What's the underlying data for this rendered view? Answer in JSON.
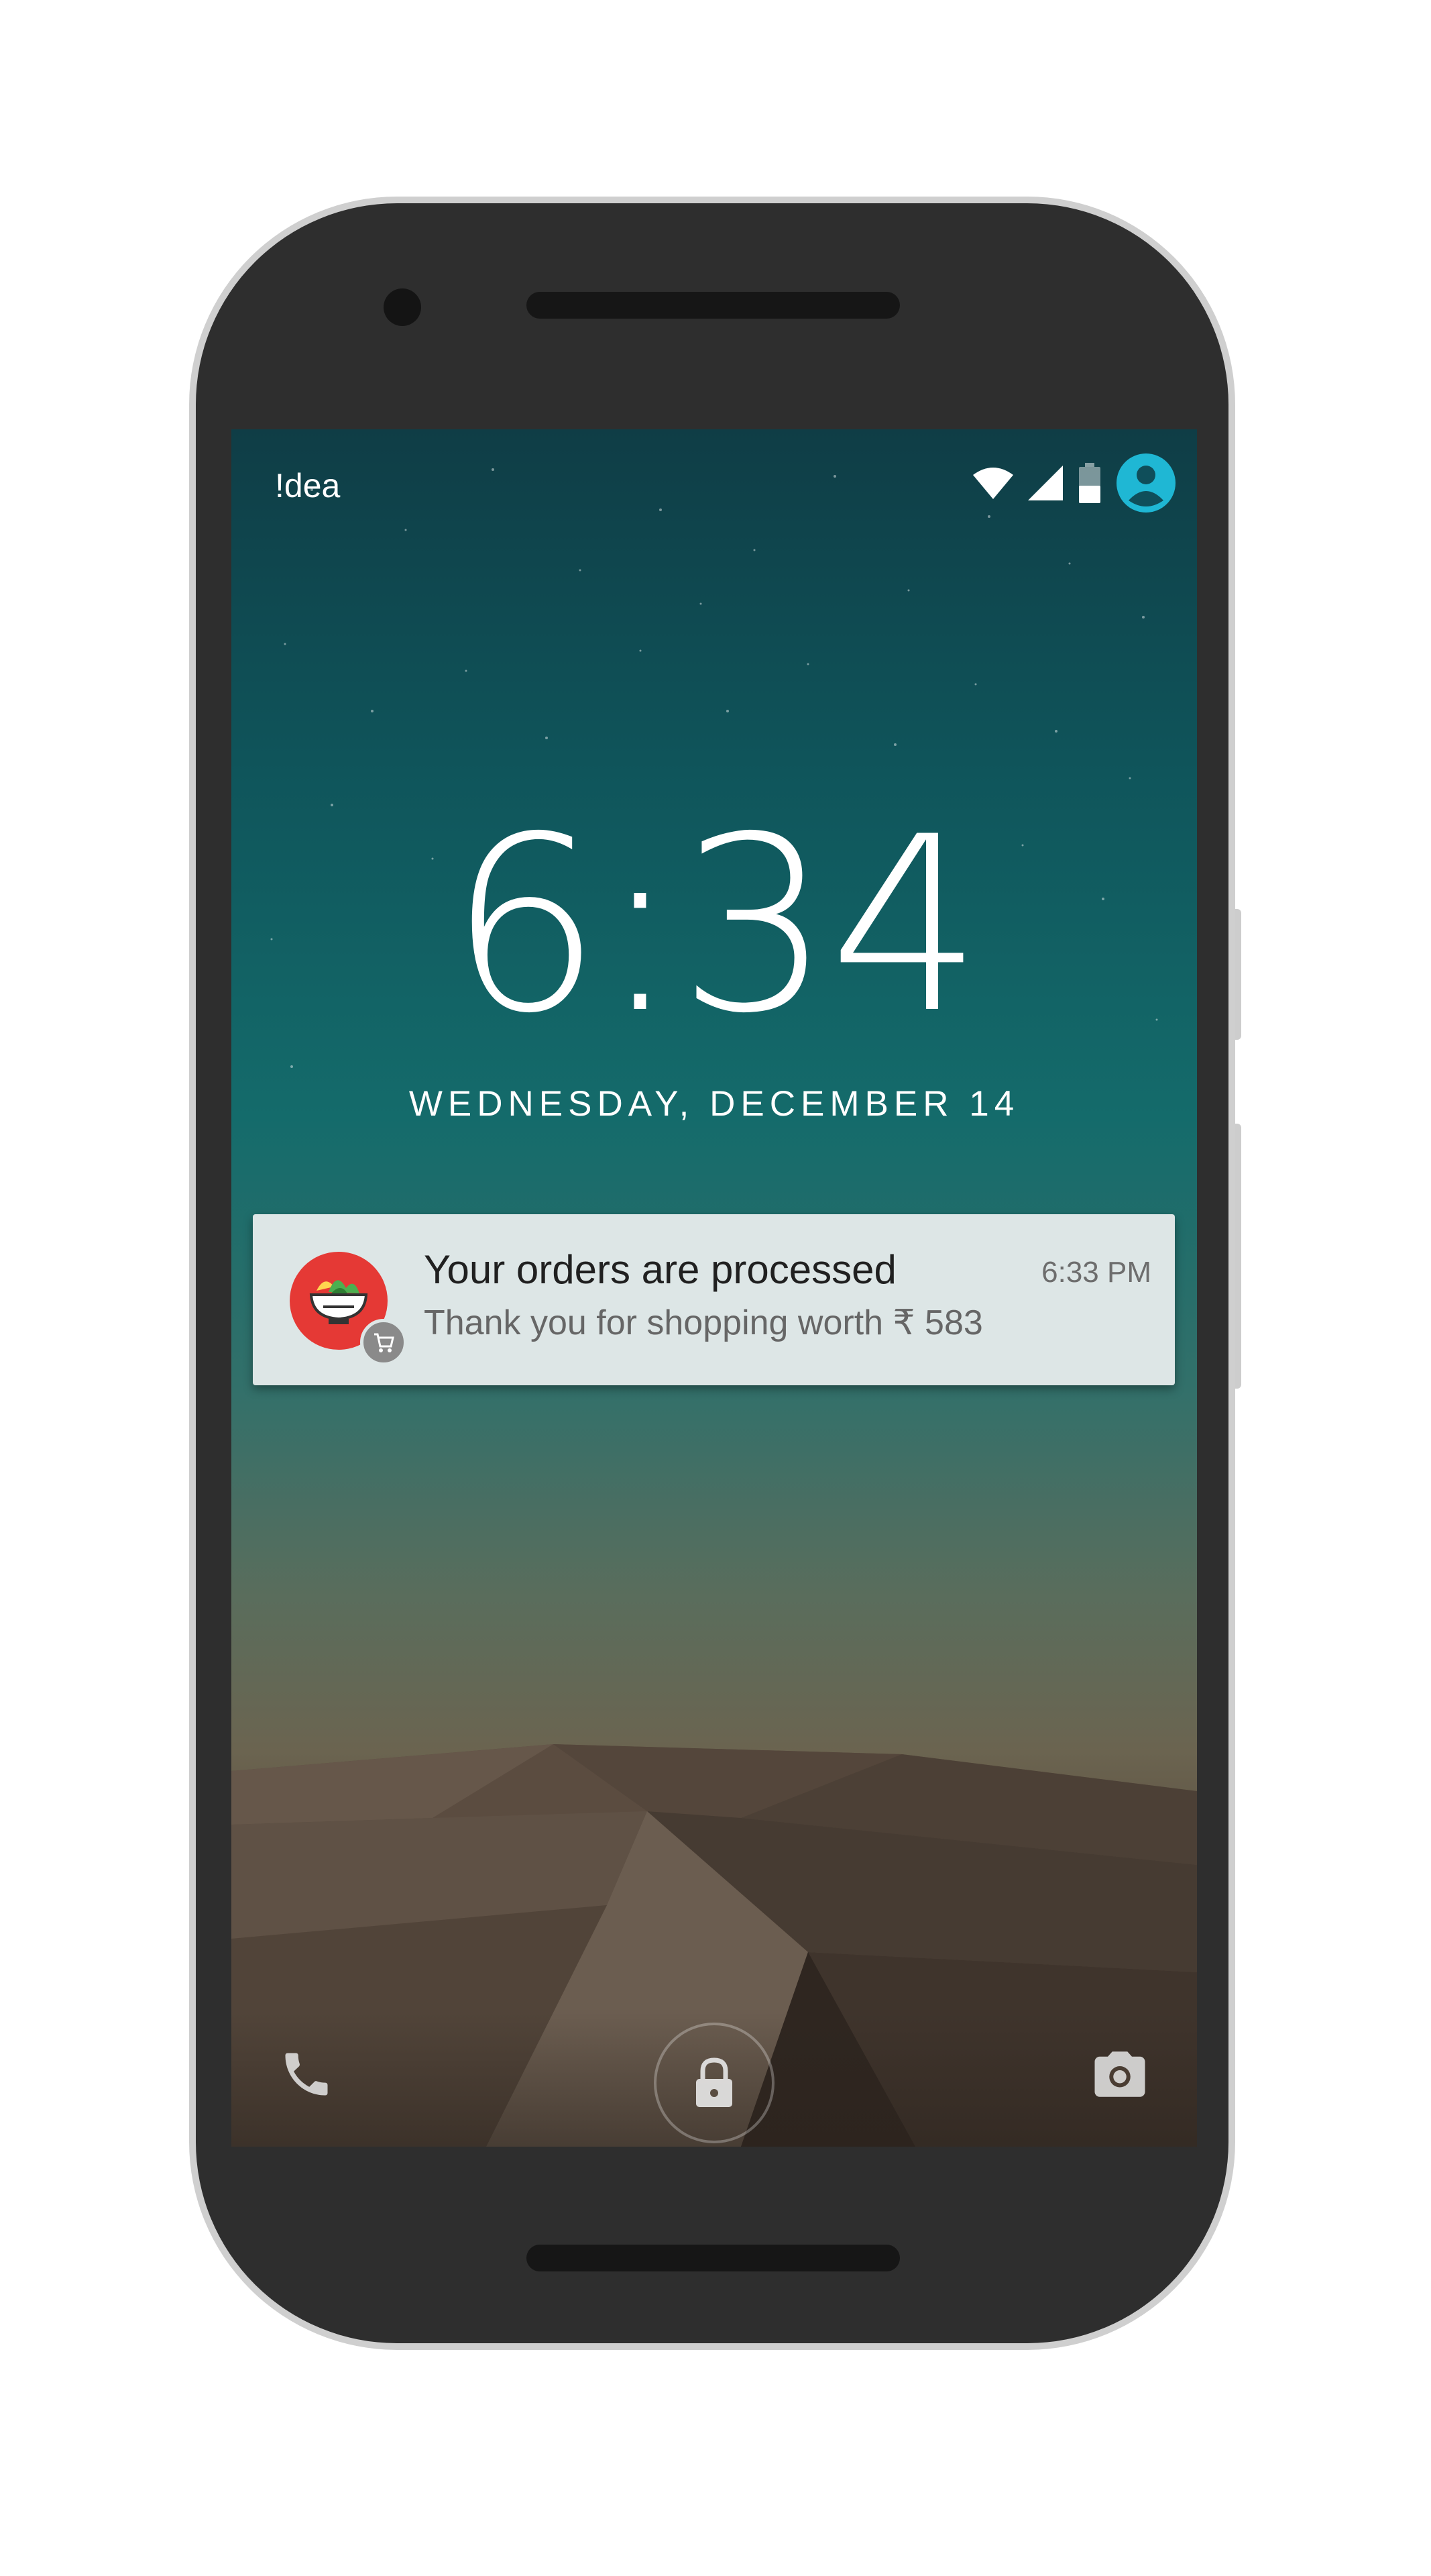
{
  "status_bar": {
    "carrier": "!dea",
    "icons": [
      "wifi-icon",
      "cellular-signal-icon",
      "battery-icon",
      "user-avatar-icon"
    ],
    "accent_color": "#1fb7d4"
  },
  "lockscreen": {
    "time": "6:34",
    "date": "WEDNESDAY, DECEMBER 14"
  },
  "notification": {
    "title": "Your orders are processed",
    "time": "6:33 PM",
    "body": "Thank you for shopping worth ₹ 583",
    "app_icon": "salad-bowl-icon",
    "badge_icon": "shopping-cart-icon",
    "icon_color": "#e53935"
  },
  "bottom_actions": {
    "left": "phone-icon",
    "center": "lock-icon",
    "right": "camera-icon"
  }
}
